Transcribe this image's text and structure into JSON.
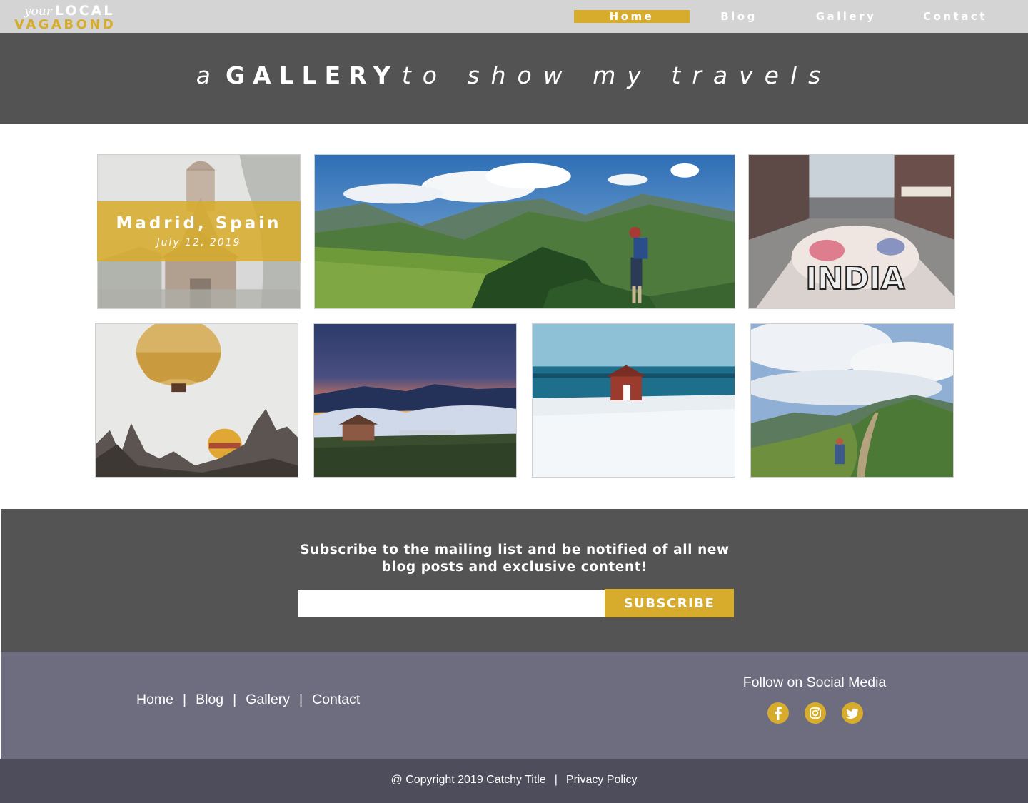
{
  "brand": {
    "prefix": "your",
    "local": "LOCAL",
    "vagabond": "VAGABOND"
  },
  "nav": {
    "items": [
      "Home",
      "Blog",
      "Gallery",
      "Contact"
    ],
    "active": "Home"
  },
  "banner": {
    "lead": "a",
    "bold": "GALLERY",
    "tail": "to show my travels"
  },
  "gallery": {
    "featured_caption": {
      "title": "Madrid, Spain",
      "date": "July 12, 2019"
    },
    "street_art_text": "INDIA",
    "photos": [
      "wooden-church-photo",
      "hiker-mountains-photo",
      "street-art-photo",
      "hot-air-balloons-photo",
      "cabin-sunset-photo",
      "red-cabin-snow-photo",
      "mountain-trail-photo"
    ]
  },
  "subscribe": {
    "message": "Subscribe to the mailing list and be notified of all new blog posts and exclusive content!",
    "input_value": "",
    "input_placeholder": "",
    "button_label": "SUBSCRIBE"
  },
  "footer": {
    "links": [
      "Home",
      "Blog",
      "Gallery",
      "Contact"
    ],
    "separator": "|",
    "social_title": "Follow on Social Media",
    "social_icons": [
      "facebook-icon",
      "instagram-icon",
      "twitter-icon"
    ]
  },
  "copyright": {
    "text": "@ Copyright 2019 Catchy Title",
    "separator": "|",
    "privacy": "Privacy Policy"
  },
  "colors": {
    "accent": "#d7ac2c",
    "nav_bg": "#d4d4d4",
    "banner_bg": "#535353",
    "subscribe_bg": "#545454",
    "footer_bg": "#6e6d80",
    "copyright_bg": "#4e4d5b"
  }
}
